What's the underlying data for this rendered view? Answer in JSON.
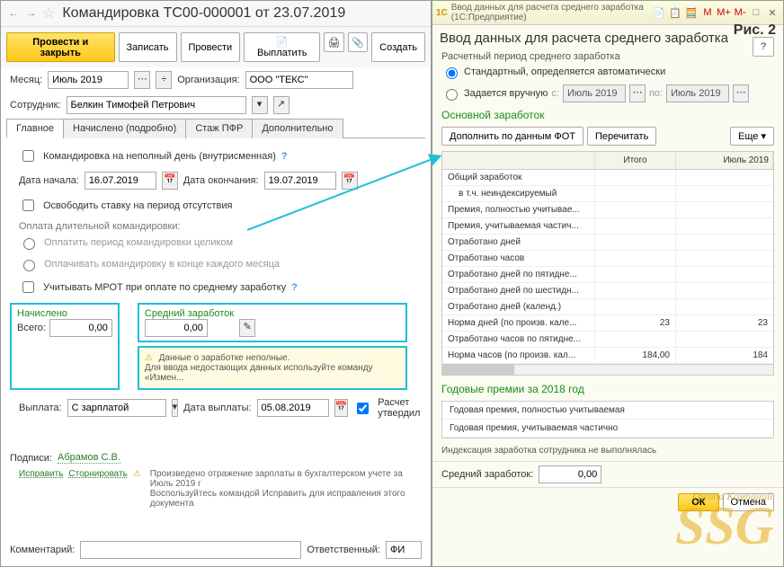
{
  "left": {
    "title": "Командировка ТС00-000001 от 23.07.2019",
    "btn_primary": "Провести и закрыть",
    "btn_save": "Записать",
    "btn_post": "Провести",
    "btn_pay": "Выплатить",
    "btn_create": "Создать",
    "month_lbl": "Месяц:",
    "month_val": "Июль 2019",
    "org_lbl": "Организация:",
    "org_val": "ООО \"ТЕКС\"",
    "emp_lbl": "Сотрудник:",
    "emp_val": "Белкин Тимофей Петрович",
    "tabs": [
      "Главное",
      "Начислено (подробно)",
      "Стаж ПФР",
      "Дополнительно"
    ],
    "cb_partial": "Командировка на неполный день (внутрисменная)",
    "date_start_lbl": "Дата начала:",
    "date_start": "16.07.2019",
    "date_end_lbl": "Дата окончания:",
    "date_end": "19.07.2019",
    "cb_free": "Освободить ставку на период отсутствия",
    "long_pay_lbl": "Оплата длительной командировки:",
    "rad_full": "Оплатить период командировки целиком",
    "rad_monthly": "Оплачивать командировку в конце каждого месяца",
    "cb_mrot": "Учитывать МРОТ при оплате по среднему заработку",
    "accrued_lbl": "Начислено",
    "avg_lbl": "Средний заработок",
    "total_lbl": "Всего:",
    "total_val": "0,00",
    "avg_val": "0,00",
    "warn1": "Данные о заработке неполные.",
    "warn2": "Для ввода недостающих данных используйте команду «Измен...",
    "payout_lbl": "Выплата:",
    "payout_val": "С зарплатой",
    "paydate_lbl": "Дата выплаты:",
    "paydate_val": "05.08.2019",
    "cb_approved": "Расчет утвердил",
    "sign_lbl": "Подписи:",
    "sign_val": "Абрамов С.В.",
    "fix_link": "Исправить",
    "storno_link": "Сторнировать",
    "footer_warn1": "Произведено отражение зарплаты в бухгалтерском учете за Июль 2019 г",
    "footer_warn2": "Воспользуйтесь командой Исправить для исправления этого документа",
    "comment_lbl": "Комментарий:",
    "resp_lbl": "Ответственный:",
    "resp_val": "ФИ"
  },
  "right": {
    "titlebar": "Ввод данных для расчета среднего заработка   (1С:Предприятие)",
    "title": "Ввод данных для расчета среднего заработка",
    "fig": "Рис. 2",
    "period_lbl": "Расчетный период среднего заработка",
    "rad_auto": "Стандартный, определяется автоматически",
    "rad_manual": "Задается вручную",
    "from_lbl": "с:",
    "from_val": "Июль 2019",
    "to_lbl": "по:",
    "to_val": "Июль 2019",
    "main_h": "Основной заработок",
    "btn_fill": "Дополнить по данным ФОТ",
    "btn_recalc": "Перечитать",
    "btn_more": "Еще",
    "col_total": "Итого",
    "col_month": "Июль 2019",
    "rows": [
      {
        "name": "Общий заработок",
        "total": "",
        "month": ""
      },
      {
        "name": "в т.ч. неиндексируемый",
        "total": "",
        "month": "",
        "indent": true
      },
      {
        "name": "Премия, полностью учитывае...",
        "total": "",
        "month": ""
      },
      {
        "name": "Премия, учитываемая частич...",
        "total": "",
        "month": ""
      },
      {
        "name": "Отработано дней",
        "total": "",
        "month": ""
      },
      {
        "name": "Отработано часов",
        "total": "",
        "month": ""
      },
      {
        "name": "Отработано дней по пятидне...",
        "total": "",
        "month": ""
      },
      {
        "name": "Отработано дней по шестидн...",
        "total": "",
        "month": ""
      },
      {
        "name": "Отработано дней (календ.)",
        "total": "",
        "month": ""
      },
      {
        "name": "Норма дней (по произв. кале...",
        "total": "23",
        "month": "23"
      },
      {
        "name": "Отработано часов по пятидне...",
        "total": "",
        "month": ""
      },
      {
        "name": "Норма часов (по произв. кал...",
        "total": "184,00",
        "month": "184"
      }
    ],
    "annual_h": "Годовые премии за 2018 год",
    "annual_rows": [
      "Годовая премия, полностью учитываемая",
      "Годовая премия, учитываемая частично"
    ],
    "idx_msg": "Индексация заработка сотрудника не выполнялась",
    "avg_bottom_lbl": "Средний заработок:",
    "avg_bottom_val": "0,00",
    "ok": "ОК",
    "cancel": "Отмена",
    "wm_sub": "Группа Компаний",
    "wm": "SSG"
  }
}
